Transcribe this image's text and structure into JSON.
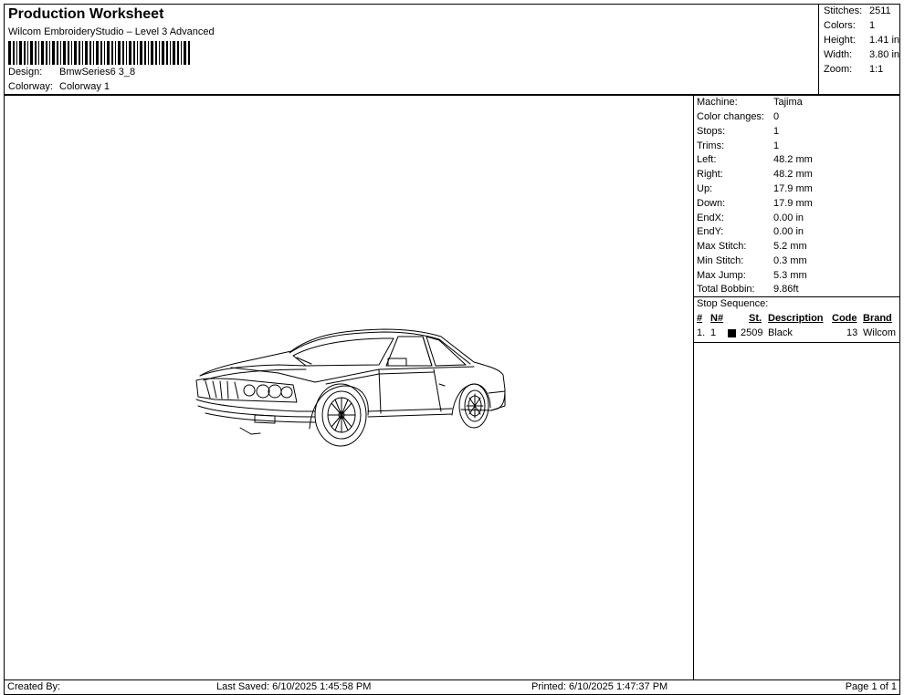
{
  "header": {
    "title": "Production Worksheet",
    "subtitle": "Wilcom EmbroideryStudio – Level 3 Advanced",
    "design_label": "Design:",
    "design_value": "BmwSeries6 3_8",
    "colorway_label": "Colorway:",
    "colorway_value": "Colorway 1"
  },
  "summary": [
    {
      "label": "Stitches:",
      "value": "2511"
    },
    {
      "label": "Colors:",
      "value": "1"
    },
    {
      "label": "Height:",
      "value": "1.41 in"
    },
    {
      "label": "Width:",
      "value": "3.80 in"
    },
    {
      "label": "Zoom:",
      "value": "1:1"
    }
  ],
  "info": [
    {
      "label": "Machine:",
      "value": "Tajima"
    },
    {
      "label": "Color changes:",
      "value": "0"
    },
    {
      "label": "Stops:",
      "value": "1"
    },
    {
      "label": "Trims:",
      "value": "1"
    },
    {
      "label": "Left:",
      "value": "48.2 mm"
    },
    {
      "label": "Right:",
      "value": "48.2 mm"
    },
    {
      "label": "Up:",
      "value": "17.9 mm"
    },
    {
      "label": "Down:",
      "value": "17.9 mm"
    },
    {
      "label": "EndX:",
      "value": "0.00 in"
    },
    {
      "label": "EndY:",
      "value": "0.00 in"
    },
    {
      "label": "Max Stitch:",
      "value": "5.2 mm"
    },
    {
      "label": "Min Stitch:",
      "value": "0.3 mm"
    },
    {
      "label": "Max Jump:",
      "value": "5.3 mm"
    },
    {
      "label": "Total Bobbin:",
      "value": "9.86ft"
    }
  ],
  "stop_sequence": {
    "title": "Stop Sequence:",
    "headers": {
      "num": "#",
      "n": "N#",
      "st": "St.",
      "desc": "Description",
      "code": "Code",
      "brand": "Brand"
    },
    "rows": [
      {
        "num": "1.",
        "n": "1",
        "swatch_color": "#000000",
        "st": "2509",
        "desc": "Black",
        "code": "13",
        "brand": "Wilcom"
      }
    ]
  },
  "footer": {
    "created_by": "Created By:",
    "last_saved": "Last Saved: 6/10/2025 1:45:58 PM",
    "printed": "Printed: 6/10/2025 1:47:37 PM",
    "page": "Page 1 of 1"
  },
  "design_image": {
    "icon": "car-outline-embroidery",
    "thread_color": "#000000"
  }
}
